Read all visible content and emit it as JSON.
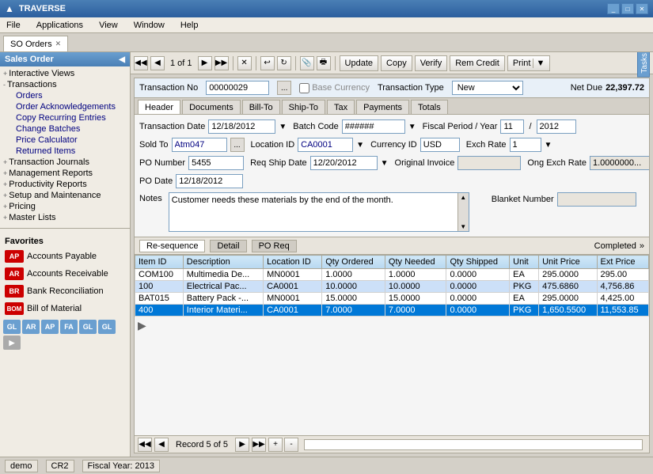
{
  "app": {
    "title": "TRAVERSE",
    "title_icon": "T"
  },
  "window_controls": {
    "minimize": "_",
    "maximize": "□",
    "close": "✕"
  },
  "menu": {
    "items": [
      "File",
      "Applications",
      "View",
      "Window",
      "Help"
    ]
  },
  "active_tab": {
    "label": "SO Orders",
    "close": "✕"
  },
  "toolbar": {
    "nav_first": "◀◀",
    "nav_prev": "◀",
    "page_info": "1 of 1",
    "nav_next": "▶",
    "nav_last": "▶▶",
    "delete_btn": "✕",
    "refresh": "↺",
    "btn_update": "Update",
    "btn_copy": "Copy",
    "btn_verify": "Verify",
    "btn_rem_credit": "Rem Credit",
    "btn_print": "Print",
    "print_arrow": "▼"
  },
  "transaction": {
    "no_label": "Transaction No",
    "no_value": "00000029",
    "base_currency_label": "Base Currency",
    "trans_type_label": "Transaction Type",
    "trans_type_value": "New",
    "net_due_label": "Net Due",
    "net_due_value": "22,397.72"
  },
  "sub_tabs": [
    "Header",
    "Documents",
    "Bill-To",
    "Ship-To",
    "Tax",
    "Payments",
    "Totals"
  ],
  "active_sub_tab": "Header",
  "header_form": {
    "trans_date_label": "Transaction Date",
    "trans_date_value": "12/18/2012",
    "batch_code_label": "Batch Code",
    "batch_code_value": "######",
    "fiscal_period_label": "Fiscal Period / Year",
    "fiscal_period_value": "11",
    "fiscal_year_value": "2012",
    "sold_to_label": "Sold To",
    "sold_to_value": "Atm047",
    "location_id_label": "Location ID",
    "location_id_value": "CA0001",
    "currency_id_label": "Currency ID",
    "currency_id_value": "USD",
    "exch_rate_label": "Exch Rate",
    "exch_rate_value": "1",
    "po_number_label": "PO Number",
    "po_number_value": "5455",
    "req_ship_date_label": "Req Ship Date",
    "req_ship_date_value": "12/20/2012",
    "original_invoice_label": "Original Invoice",
    "original_invoice_value": "",
    "ong_exch_rate_label": "Ong Exch Rate",
    "ong_exch_rate_value": "1.0000000...",
    "po_date_label": "PO Date",
    "po_date_value": "12/18/2012",
    "notes_label": "Notes",
    "notes_value": "Customer needs these materials by the end of the month.",
    "blanket_number_label": "Blanket Number",
    "blanket_number_value": ""
  },
  "table_tabs": [
    "Re-sequence",
    "Detail",
    "PO Req"
  ],
  "active_table_tab": "Detail",
  "completed_label": "Completed",
  "table_columns": [
    "Item ID",
    "Description",
    "Location ID",
    "Qty Ordered",
    "Qty Needed",
    "Qty Shipped",
    "Unit",
    "Unit Price",
    "Ext Price"
  ],
  "table_rows": [
    {
      "item_id": "COM100",
      "description": "Multimedia De...",
      "location_id": "MN0001",
      "qty_ordered": "1.0000",
      "qty_needed": "1.0000",
      "qty_shipped": "0.0000",
      "unit": "EA",
      "unit_price": "295.0000",
      "ext_price": "295.00",
      "style": "white"
    },
    {
      "item_id": "100",
      "description": "Electrical Pac...",
      "location_id": "CA0001",
      "qty_ordered": "10.0000",
      "qty_needed": "10.0000",
      "qty_shipped": "0.0000",
      "unit": "PKG",
      "unit_price": "475.6860",
      "ext_price": "4,756.86",
      "style": "blue"
    },
    {
      "item_id": "BAT015",
      "description": "Battery Pack -...",
      "location_id": "MN0001",
      "qty_ordered": "15.0000",
      "qty_needed": "15.0000",
      "qty_shipped": "0.0000",
      "unit": "EA",
      "unit_price": "295.0000",
      "ext_price": "4,425.00",
      "style": "white"
    },
    {
      "item_id": "400",
      "description": "Interior Materi...",
      "location_id": "CA0001",
      "qty_ordered": "7.0000",
      "qty_needed": "7.0000",
      "qty_shipped": "0.0000",
      "unit": "PKG",
      "unit_price": "1,650.5500",
      "ext_price": "11,553.85",
      "style": "selected"
    }
  ],
  "bottom_nav": {
    "first": "◀◀",
    "prev": "◀",
    "record_info": "Record 5 of 5",
    "next": "▶",
    "last": "▶▶",
    "add": "+",
    "remove": "-"
  },
  "sidebar": {
    "header": "Sales Order",
    "items": [
      {
        "label": "Interactive Views",
        "level": 1,
        "icon": "+"
      },
      {
        "label": "Transactions",
        "level": 1,
        "icon": "-"
      },
      {
        "label": "Orders",
        "level": 2,
        "icon": ""
      },
      {
        "label": "Order Acknowledgements",
        "level": 2,
        "icon": ""
      },
      {
        "label": "Copy Recurring Entries",
        "level": 2,
        "icon": ""
      },
      {
        "label": "Change Batches",
        "level": 2,
        "icon": ""
      },
      {
        "label": "Price Calculator",
        "level": 2,
        "icon": ""
      },
      {
        "label": "Returned Items",
        "level": 2,
        "icon": ""
      },
      {
        "label": "Transaction Journals",
        "level": 1,
        "icon": "+"
      },
      {
        "label": "Management Reports",
        "level": 1,
        "icon": "+"
      },
      {
        "label": "Productivity Reports",
        "level": 1,
        "icon": "+"
      },
      {
        "label": "Setup and Maintenance",
        "level": 1,
        "icon": "+"
      },
      {
        "label": "Pricing",
        "level": 1,
        "icon": "+"
      },
      {
        "label": "Master Lists",
        "level": 1,
        "icon": "+"
      }
    ],
    "favorites_title": "Favorites",
    "favorites": [
      {
        "label": "Accounts Payable",
        "icon": "AP",
        "color": "#c00"
      },
      {
        "label": "Accounts Receivable",
        "icon": "AR",
        "color": "#c00"
      },
      {
        "label": "Bank Reconciliation",
        "icon": "BR",
        "color": "#c00"
      },
      {
        "label": "Bill of Material",
        "icon": "BOM",
        "color": "#c00"
      }
    ],
    "quick_icons": [
      {
        "label": "GL",
        "color": "#6a9fd0"
      },
      {
        "label": "AR",
        "color": "#6a9fd0"
      },
      {
        "label": "AP",
        "color": "#6a9fd0"
      },
      {
        "label": "FA",
        "color": "#6a9fd0"
      },
      {
        "label": "GL",
        "color": "#6a9fd0"
      },
      {
        "label": "GL",
        "color": "#6a9fd0"
      }
    ]
  },
  "status_bar": {
    "demo": "demo",
    "cr2": "CR2",
    "fiscal_year": "Fiscal Year: 2013"
  },
  "tasks_label": "Tasks"
}
